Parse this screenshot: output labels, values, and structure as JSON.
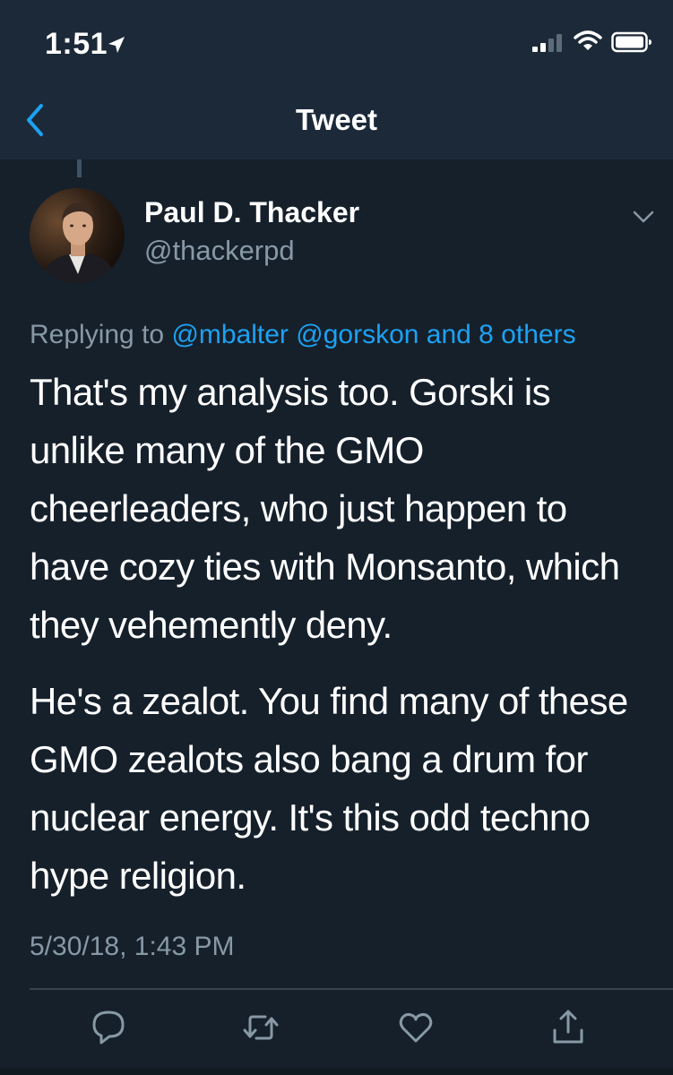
{
  "status_bar": {
    "time": "1:51",
    "icons": [
      "location-arrow-icon",
      "signal-icon",
      "wifi-icon",
      "battery-icon"
    ]
  },
  "header": {
    "title": "Tweet",
    "back_icon": "chevron-left-icon"
  },
  "tweet": {
    "author": {
      "display_name": "Paul D. Thacker",
      "handle": "@thackerpd",
      "avatar": "profile-photo"
    },
    "replying_to": {
      "prefix": "Replying to",
      "mentions": "@mbalter @gorskon and 8 others"
    },
    "paragraphs": [
      "That's my analysis too. Gorski is\nunlike many of the GMO\ncheerleaders, who just happen to\nhave cozy ties with Monsanto, which\nthey vehemently deny.",
      "He's a zealot. You find many of these\nGMO zealots also bang a drum for\nnuclear energy. It's this odd techno\nhype religion."
    ],
    "timestamp": "5/30/18, 1:43 PM",
    "actions": [
      "reply-icon",
      "retweet-icon",
      "like-icon",
      "share-icon"
    ]
  },
  "colors": {
    "background": "#15202b",
    "header_background": "#1c2938",
    "accent": "#1da1f2",
    "secondary_text": "#8899a6",
    "divider": "#38444d"
  }
}
